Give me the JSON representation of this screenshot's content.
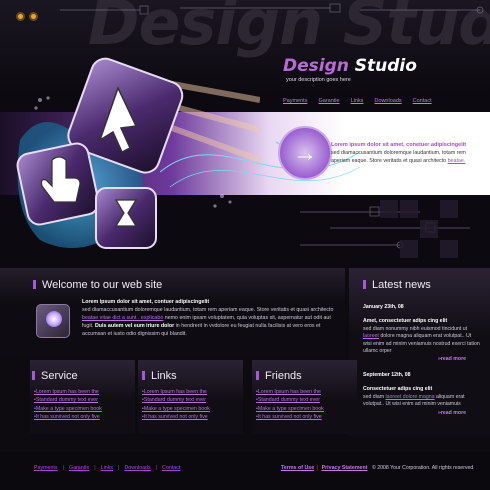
{
  "header": {
    "watermark": "Design Studio",
    "brand_part1": "Design",
    "brand_part2": "Studio",
    "tagline": "your description goes here",
    "nav": [
      "Payments",
      "Garantie",
      "Links",
      "Downloads",
      "Contact"
    ]
  },
  "band": {
    "title": "Lorem ipsum dolor sit amet, conetuer adipiscingelit",
    "body": "sed diamaccusantium doloremque laudantium, totam rem aperiam eaque. Store veritatis et quasi architecto",
    "link": "beatae."
  },
  "welcome": {
    "title": "Welcome to our web site",
    "lead": "Lorem ipsum dolor sit amet, contuer adipiscingelit",
    "line1": "sed diamaccusantium doloremque laudantium, totam rem aperiam eaque. Store veritatis et quasi architecto",
    "link": "beatae vitae dict a sunt . explicabo",
    "line2": " nemo enim ipsam voluptatem, quia voluptas sit, aspernatur aut odit aut fugit.",
    "strong": " Duis autem vel eum iriure dolor",
    "line3": " in hendrerit in vvdolore eu feugiat nulla facilisis at vero eros et accumsan et iusto odio dignissim qui blandit."
  },
  "news": {
    "title": "Latest news",
    "items": [
      {
        "date": "January 23th, 08",
        "heading": "Amet, consectetuer adips cing elit",
        "pre": "sed diam nonummy nibh euismod tincidunt ut ",
        "link": "laoreet",
        "post": " dolore magna aliquam erat volutpat.. Ut wisi enim ad minim veniamuis nostrud exerci tation ullamc orper",
        "more": "read more"
      },
      {
        "date": "September 12th, 08",
        "heading": "Consectetuer adips cing elit",
        "pre": "sed diam ",
        "link": "laoreet dolore magna",
        "post": " aliquam erat volutpat.. Ut wisi enim ad minim veniamuis",
        "more": "read more"
      }
    ]
  },
  "columns": [
    {
      "title": "Service",
      "items": [
        "Lorem Ipsum has been the",
        "Standard dummy text ever",
        "Make a type specimen book",
        "It has survived not only five"
      ]
    },
    {
      "title": "Links",
      "items": [
        "Lorem Ipsum has been the",
        "Standard dummy text ever",
        "Make a type specimen book",
        "It has survived not only five"
      ]
    },
    {
      "title": "Friends",
      "items": [
        "Lorem Ipsum has been the",
        "Standard dummy text ever",
        "Make a type specimen book",
        "It has survived not only five"
      ]
    }
  ],
  "footer": {
    "nav": [
      "Payments",
      "Garantie",
      "Links",
      "Downloads",
      "Contact"
    ],
    "separator": "|",
    "terms": "Terms of Use",
    "privacy": "Privacy Statement",
    "copyright": "© 2008 Your Corporation. All rights reserved"
  },
  "colors": {
    "accent": "#a45bd7",
    "link": "#c17be4",
    "background": "#0d0b10"
  }
}
